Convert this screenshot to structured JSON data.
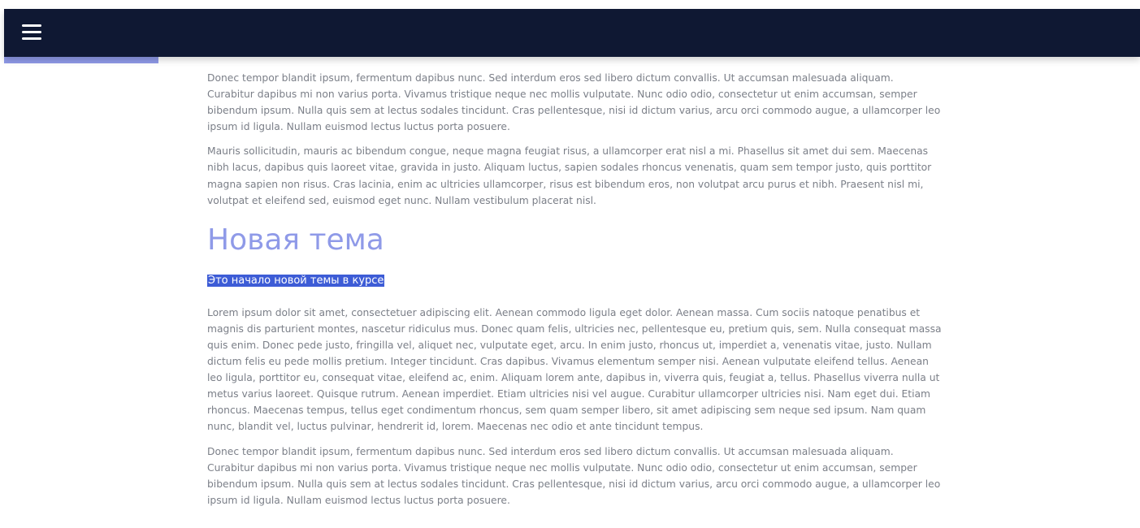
{
  "header": {
    "menu_icon": "hamburger-menu-icon",
    "background_color": "#0f1833"
  },
  "progress": {
    "value_percent": 13.6,
    "color": "#8f9ae8"
  },
  "content": {
    "paragraphs_before": [
      "Donec tempor blandit ipsum, fermentum dapibus nunc. Sed interdum eros sed libero dictum convallis. Ut accumsan malesuada aliquam. Curabitur dapibus mi non varius porta. Vivamus tristique neque nec mollis vulputate. Nunc odio odio, consectetur ut enim accumsan, semper bibendum ipsum. Nulla quis sem at lectus sodales tincidunt. Cras pellentesque, nisi id dictum varius, arcu orci commodo augue, a ullamcorper leo ipsum id ligula. Nullam euismod lectus luctus porta posuere.",
      "Mauris sollicitudin, mauris ac bibendum congue, neque magna feugiat risus, a ullamcorper erat nisl a mi. Phasellus sit amet dui sem. Maecenas nibh lacus, dapibus quis laoreet vitae, gravida in justo. Aliquam luctus, sapien sodales rhoncus venenatis, quam sem tempor justo, quis porttitor magna sapien non risus. Cras lacinia, enim ac ultricies ullamcorper, risus est bibendum eros, non volutpat arcu purus et nibh. Praesent nisl mi, volutpat et eleifend sed, euismod eget nunc. Nullam vestibulum placerat nisl."
    ],
    "section_title": "Новая тема",
    "section_subtitle": "Это начало новой темы в курсе",
    "paragraphs_after": [
      "Lorem ipsum dolor sit amet, consectetuer adipiscing elit. Aenean commodo ligula eget dolor. Aenean massa. Cum sociis natoque penatibus et magnis dis parturient montes, nascetur ridiculus mus. Donec quam felis, ultricies nec, pellentesque eu, pretium quis, sem. Nulla consequat massa quis enim. Donec pede justo, fringilla vel, aliquet nec, vulputate eget, arcu. In enim justo, rhoncus ut, imperdiet a, venenatis vitae, justo. Nullam dictum felis eu pede mollis pretium. Integer tincidunt. Cras dapibus. Vivamus elementum semper nisi. Aenean vulputate eleifend tellus. Aenean leo ligula, porttitor eu, consequat vitae, eleifend ac, enim. Aliquam lorem ante, dapibus in, viverra quis, feugiat a, tellus. Phasellus viverra nulla ut metus varius laoreet. Quisque rutrum. Aenean imperdiet. Etiam ultricies nisi vel augue. Curabitur ullamcorper ultricies nisi. Nam eget dui. Etiam rhoncus. Maecenas tempus, tellus eget condimentum rhoncus, sem quam semper libero, sit amet adipiscing sem neque sed ipsum. Nam quam nunc, blandit vel, luctus pulvinar, hendrerit id, lorem. Maecenas nec odio et ante tincidunt tempus.",
      "Donec tempor blandit ipsum, fermentum dapibus nunc. Sed interdum eros sed libero dictum convallis. Ut accumsan malesuada aliquam. Curabitur dapibus mi non varius porta. Vivamus tristique neque nec mollis vulputate. Nunc odio odio, consectetur ut enim accumsan, semper bibendum ipsum. Nulla quis sem at lectus sodales tincidunt. Cras pellentesque, nisi id dictum varius, arcu orci commodo augue, a ullamcorper leo ipsum id ligula. Nullam euismod lectus luctus porta posuere."
    ]
  }
}
